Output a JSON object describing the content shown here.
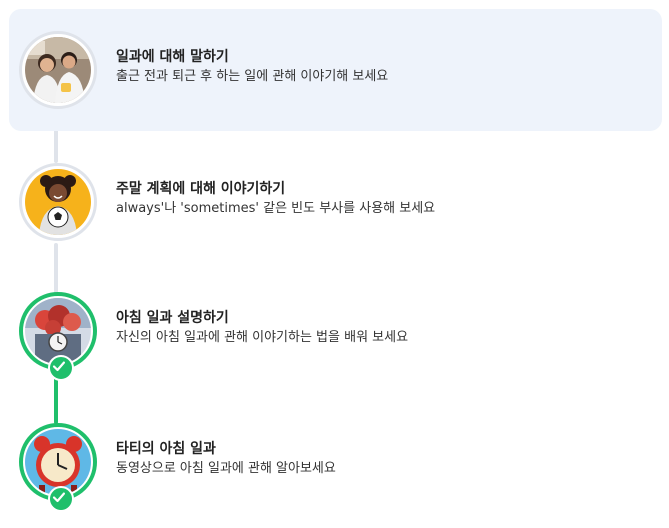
{
  "lessons": [
    {
      "title": "일과에 대해 말하기",
      "description": "출근 전과 퇴근 후 하는 일에 관해 이야기해 보세요",
      "completed": false,
      "active": true,
      "thumbnail": "couple-photo"
    },
    {
      "title": "주말 계획에 대해 이야기하기",
      "description": "always'나 'sometimes' 같은 빈도 부사를 사용해 보세요",
      "completed": false,
      "active": false,
      "thumbnail": "girl-with-soccer-ball"
    },
    {
      "title": "아침 일과 설명하기",
      "description": "자신의 아침 일과에 관해 이야기하는 법을 배워 보세요",
      "completed": true,
      "active": false,
      "thumbnail": "clock-with-flowers"
    },
    {
      "title": "타티의 아침 일과",
      "description": "동영상으로 아침 일과에 관해 알아보세요",
      "completed": true,
      "active": false,
      "thumbnail": "red-alarm-clock"
    }
  ],
  "colors": {
    "active_background": "#eef3fb",
    "completed_green": "#1fbf6b",
    "pending_gray": "#dfe3ea"
  }
}
